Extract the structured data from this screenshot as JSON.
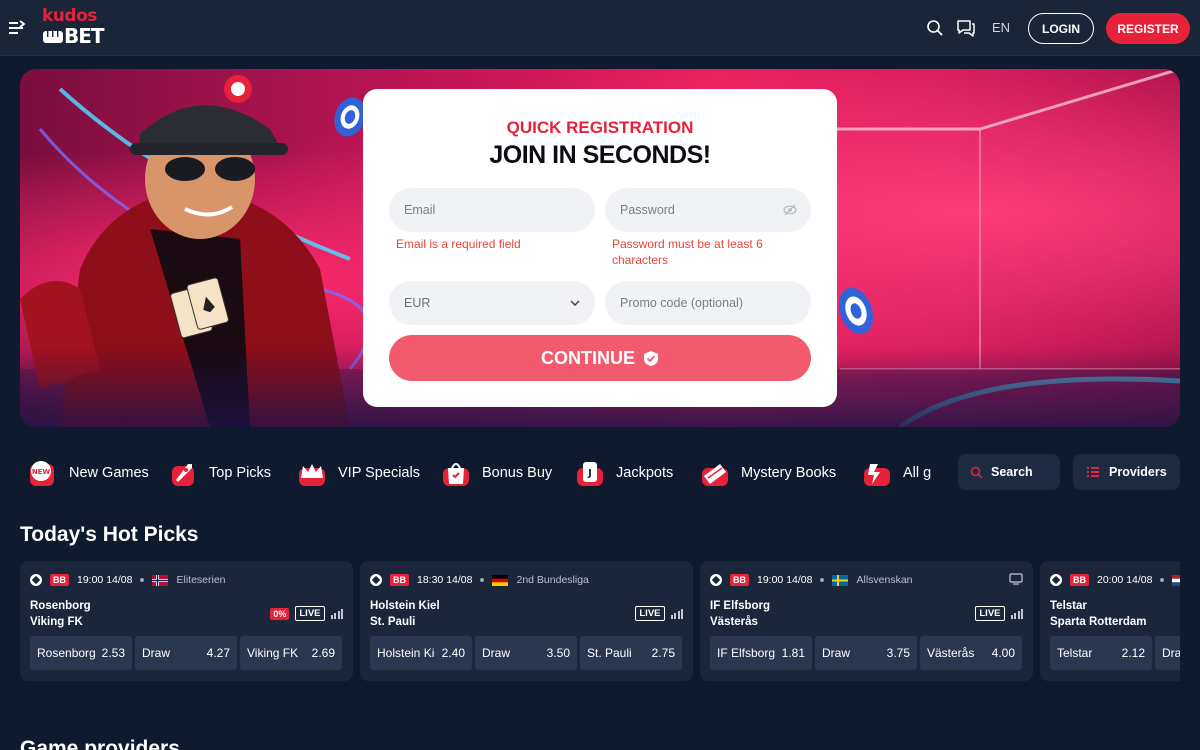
{
  "header": {
    "logo_line1": "kudos",
    "logo_line2": "BET",
    "language": "EN",
    "login_label": "LOGIN",
    "register_label": "REGISTER",
    "accent_color": "#e8213b"
  },
  "registration": {
    "kicker": "QUICK REGISTRATION",
    "title": "JOIN IN SECONDS!",
    "email_placeholder": "Email",
    "email_error": "Email is a required field",
    "password_placeholder": "Password",
    "password_error": "Password must be at least 6 characters",
    "currency_value": "EUR",
    "promo_placeholder": "Promo code (optional)",
    "continue_label": "CONTINUE"
  },
  "categories": [
    {
      "label": "New Games",
      "icon": "new-badge-icon"
    },
    {
      "label": "Top Picks",
      "icon": "rocket-icon"
    },
    {
      "label": "VIP Specials",
      "icon": "crown-icon"
    },
    {
      "label": "Bonus Buy",
      "icon": "shopping-bag-icon"
    },
    {
      "label": "Jackpots",
      "icon": "jackpot-card-icon"
    },
    {
      "label": "Mystery Books",
      "icon": "book-icon"
    },
    {
      "label": "All g",
      "icon": "all-games-icon"
    }
  ],
  "search_label": "Search",
  "providers_label": "Providers",
  "hot_picks": {
    "title": "Today's Hot Picks",
    "matches": [
      {
        "time": "19:00",
        "date": "14/08",
        "league": "Eliteserien",
        "flag": "norway",
        "home": "Rosenborg",
        "away": "Viking FK",
        "margin": "0%",
        "live": "LIVE",
        "odds": [
          {
            "name": "Rosenborg",
            "value": "2.53"
          },
          {
            "name": "Draw",
            "value": "4.27"
          },
          {
            "name": "Viking FK",
            "value": "2.69"
          }
        ]
      },
      {
        "time": "18:30",
        "date": "14/08",
        "league": "2nd Bundesliga",
        "flag": "germany",
        "home": "Holstein Kiel",
        "away": "St. Pauli",
        "live": "LIVE",
        "odds": [
          {
            "name": "Holstein Kiel",
            "value": "2.40"
          },
          {
            "name": "Draw",
            "value": "3.50"
          },
          {
            "name": "St. Pauli",
            "value": "2.75"
          }
        ]
      },
      {
        "time": "19:00",
        "date": "14/08",
        "league": "Allsvenskan",
        "flag": "sweden",
        "home": "IF Elfsborg",
        "away": "Västerås",
        "live": "LIVE",
        "odds": [
          {
            "name": "IF Elfsborg",
            "value": "1.81"
          },
          {
            "name": "Draw",
            "value": "3.75"
          },
          {
            "name": "Västerås",
            "value": "4.00"
          }
        ]
      },
      {
        "time": "20:00",
        "date": "14/08",
        "league": "",
        "flag": "netherlands",
        "home": "Telstar",
        "away": "Sparta Rotterdam",
        "odds": [
          {
            "name": "Telstar",
            "value": "2.12"
          },
          {
            "name": "Draw",
            "value": ""
          }
        ]
      }
    ],
    "bb_label": "BB"
  },
  "providers_section": {
    "title": "Game providers"
  }
}
